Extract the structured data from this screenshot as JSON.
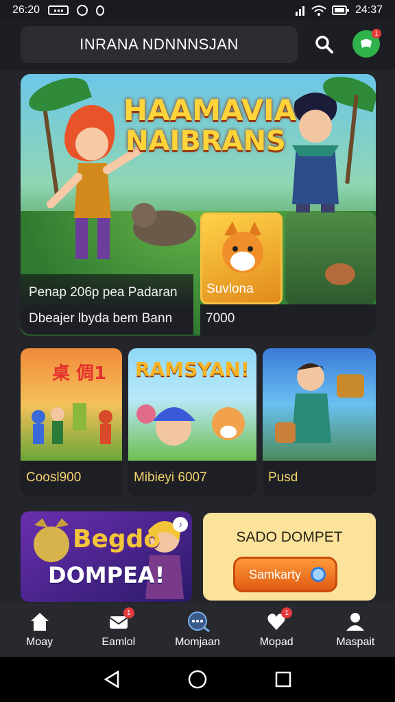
{
  "status_bar": {
    "time": "26:20",
    "clock_right": "24:37"
  },
  "header": {
    "title": "INRANA NDNNNSJAN",
    "profile_badge": "1"
  },
  "hero": {
    "title_line1": "HAAMAVIA",
    "title_line2": "NAIBRANS",
    "caption_left_1": "Penap 206p pea Padaran",
    "caption_left_2": "Dbeajer lbyda bem Bann",
    "caption_right_1": "Suvlona",
    "caption_right_2": "7000"
  },
  "cards": [
    {
      "art_title": "桌 倜1",
      "label": "Coosl900"
    },
    {
      "art_title": "RAMSYAN!",
      "label": "Mibieyi  6007"
    },
    {
      "art_title": "",
      "label": "Pusd"
    }
  ],
  "promos": {
    "left_line1": "Begdo",
    "left_line2": "DOMPEA!",
    "right_title": "SADO DOMPET",
    "right_button": "Samkarty"
  },
  "bottom_nav": {
    "items": [
      {
        "label": "Moay",
        "icon": "home-icon",
        "badge": ""
      },
      {
        "label": "Eamlol",
        "icon": "mail-icon",
        "badge": "1"
      },
      {
        "label": "Momjaan",
        "icon": "chat-search-icon",
        "badge": ""
      },
      {
        "label": "Mopad",
        "icon": "heart-chat-icon",
        "badge": "1"
      },
      {
        "label": "Maspait",
        "icon": "person-icon",
        "badge": ""
      }
    ]
  },
  "colors": {
    "background": "#202228",
    "accent_gold": "#f3d36e",
    "badge_red": "#e43b3b",
    "profile_green": "#2fb34a",
    "button_orange": "#e05b12"
  }
}
